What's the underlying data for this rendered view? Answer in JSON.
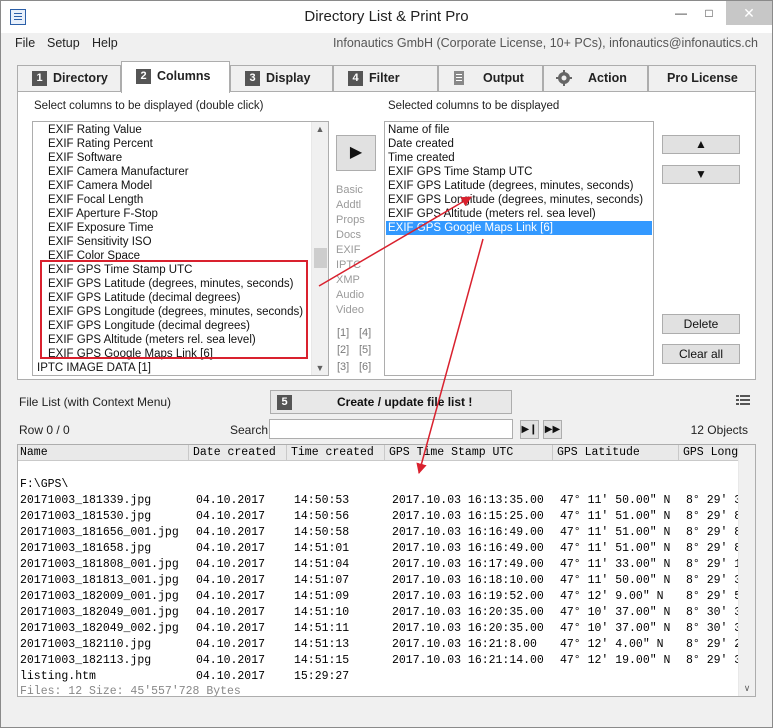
{
  "window": {
    "title": "Directory List & Print Pro"
  },
  "menu": {
    "items": [
      "File",
      "Setup",
      "Help"
    ],
    "company": "Infonautics GmbH (Corporate License, 10+ PCs), infonautics@infonautics.ch"
  },
  "tabs": [
    {
      "num": "1",
      "label": "Directory"
    },
    {
      "num": "2",
      "label": "Columns"
    },
    {
      "num": "3",
      "label": "Display"
    },
    {
      "num": "4",
      "label": "Filter"
    },
    {
      "num": "",
      "label": "Output"
    },
    {
      "num": "",
      "label": "Action"
    },
    {
      "num": "",
      "label": "Pro License"
    }
  ],
  "columns_panel": {
    "left_caption": "Select columns to be displayed (double click)",
    "right_caption": "Selected columns to be displayed",
    "available": [
      "EXIF Rating Value",
      "EXIF Rating Percent",
      "EXIF Software",
      "EXIF Camera Manufacturer",
      "EXIF Camera Model",
      "EXIF Focal Length",
      "EXIF Aperture F-Stop",
      "EXIF Exposure Time",
      "EXIF Sensitivity ISO",
      "EXIF Color Space",
      "EXIF GPS Time Stamp UTC",
      "EXIF GPS Latitude  (degrees, minutes, seconds)",
      "EXIF GPS Latitude  (decimal degrees)",
      "EXIF GPS Longitude  (degrees, minutes, seconds)",
      "EXIF GPS Longitude  (decimal degrees)",
      "EXIF GPS Altitude  (meters rel. sea level)",
      "EXIF GPS Google Maps Link [6]",
      "IPTC IMAGE DATA [1]"
    ],
    "selected": [
      "Name of file",
      "Date created",
      "Time created",
      "EXIF GPS Time Stamp UTC",
      "EXIF GPS Latitude  (degrees, minutes, seconds)",
      "EXIF GPS Longitude  (degrees, minutes, seconds)",
      "EXIF GPS Altitude  (meters rel. sea level)",
      "EXIF GPS Google Maps Link [6]"
    ],
    "add_button": "▶",
    "categories": [
      "Basic",
      "Addtl",
      "Props",
      "Docs",
      "EXIF",
      "IPTC",
      "XMP",
      "Audio",
      "Video"
    ],
    "num_links": [
      "[1]",
      "[4]",
      "[2]",
      "[5]",
      "[3]",
      "[6]"
    ],
    "up_button": "▲",
    "down_button": "▼",
    "delete_button": "Delete",
    "clear_button": "Clear all"
  },
  "file_list": {
    "caption": "File List (with Context Menu)",
    "step": "5",
    "create_button": "Create / update file list !",
    "row_info": "Row 0 / 0",
    "search_label": "Search",
    "search_value": "",
    "objects": "12 Objects",
    "headers": [
      "Name",
      "Date created",
      "Time created",
      "GPS Time Stamp UTC",
      "GPS Latitude",
      "GPS Long"
    ],
    "folder": "F:\\GPS\\",
    "rows": [
      [
        "20171003_181339.jpg",
        "04.10.2017",
        "14:50:53",
        "2017.10.03 16:13:35.00",
        "47° 11' 50.00\" N",
        "8° 29' 3"
      ],
      [
        "20171003_181530.jpg",
        "04.10.2017",
        "14:50:56",
        "2017.10.03 16:15:25.00",
        "47° 11' 51.00\" N",
        "8° 29' 8"
      ],
      [
        "20171003_181656_001.jpg",
        "04.10.2017",
        "14:50:58",
        "2017.10.03 16:16:49.00",
        "47° 11' 51.00\" N",
        "8° 29' 8"
      ],
      [
        "20171003_181658.jpg",
        "04.10.2017",
        "14:51:01",
        "2017.10.03 16:16:49.00",
        "47° 11' 51.00\" N",
        "8° 29' 8"
      ],
      [
        "20171003_181808_001.jpg",
        "04.10.2017",
        "14:51:04",
        "2017.10.03 16:17:49.00",
        "47° 11' 33.00\" N",
        "8° 29' 1"
      ],
      [
        "20171003_181813_001.jpg",
        "04.10.2017",
        "14:51:07",
        "2017.10.03 16:18:10.00",
        "47° 11' 50.00\" N",
        "8° 29' 3"
      ],
      [
        "20171003_182009_001.jpg",
        "04.10.2017",
        "14:51:09",
        "2017.10.03 16:19:52.00",
        "47° 12' 9.00\" N",
        "8° 29' 5"
      ],
      [
        "20171003_182049_001.jpg",
        "04.10.2017",
        "14:51:10",
        "2017.10.03 16:20:35.00",
        "47° 10' 37.00\" N",
        "8° 30' 3"
      ],
      [
        "20171003_182049_002.jpg",
        "04.10.2017",
        "14:51:11",
        "2017.10.03 16:20:35.00",
        "47° 10' 37.00\" N",
        "8° 30' 3"
      ],
      [
        "20171003_182110.jpg",
        "04.10.2017",
        "14:51:13",
        "2017.10.03 16:21:8.00",
        "47° 12' 4.00\" N",
        "8° 29' 2"
      ],
      [
        "20171003_182113.jpg",
        "04.10.2017",
        "14:51:15",
        "2017.10.03 16:21:14.00",
        "47° 12' 19.00\" N",
        "8° 29' 3"
      ],
      [
        "listing.htm",
        "04.10.2017",
        "15:29:27",
        "",
        "",
        ""
      ]
    ],
    "footer": "Files: 12      Size: 45'557'728 Bytes"
  },
  "colors": {
    "highlight": "#3399ff",
    "annotation_red": "#d9212e"
  }
}
